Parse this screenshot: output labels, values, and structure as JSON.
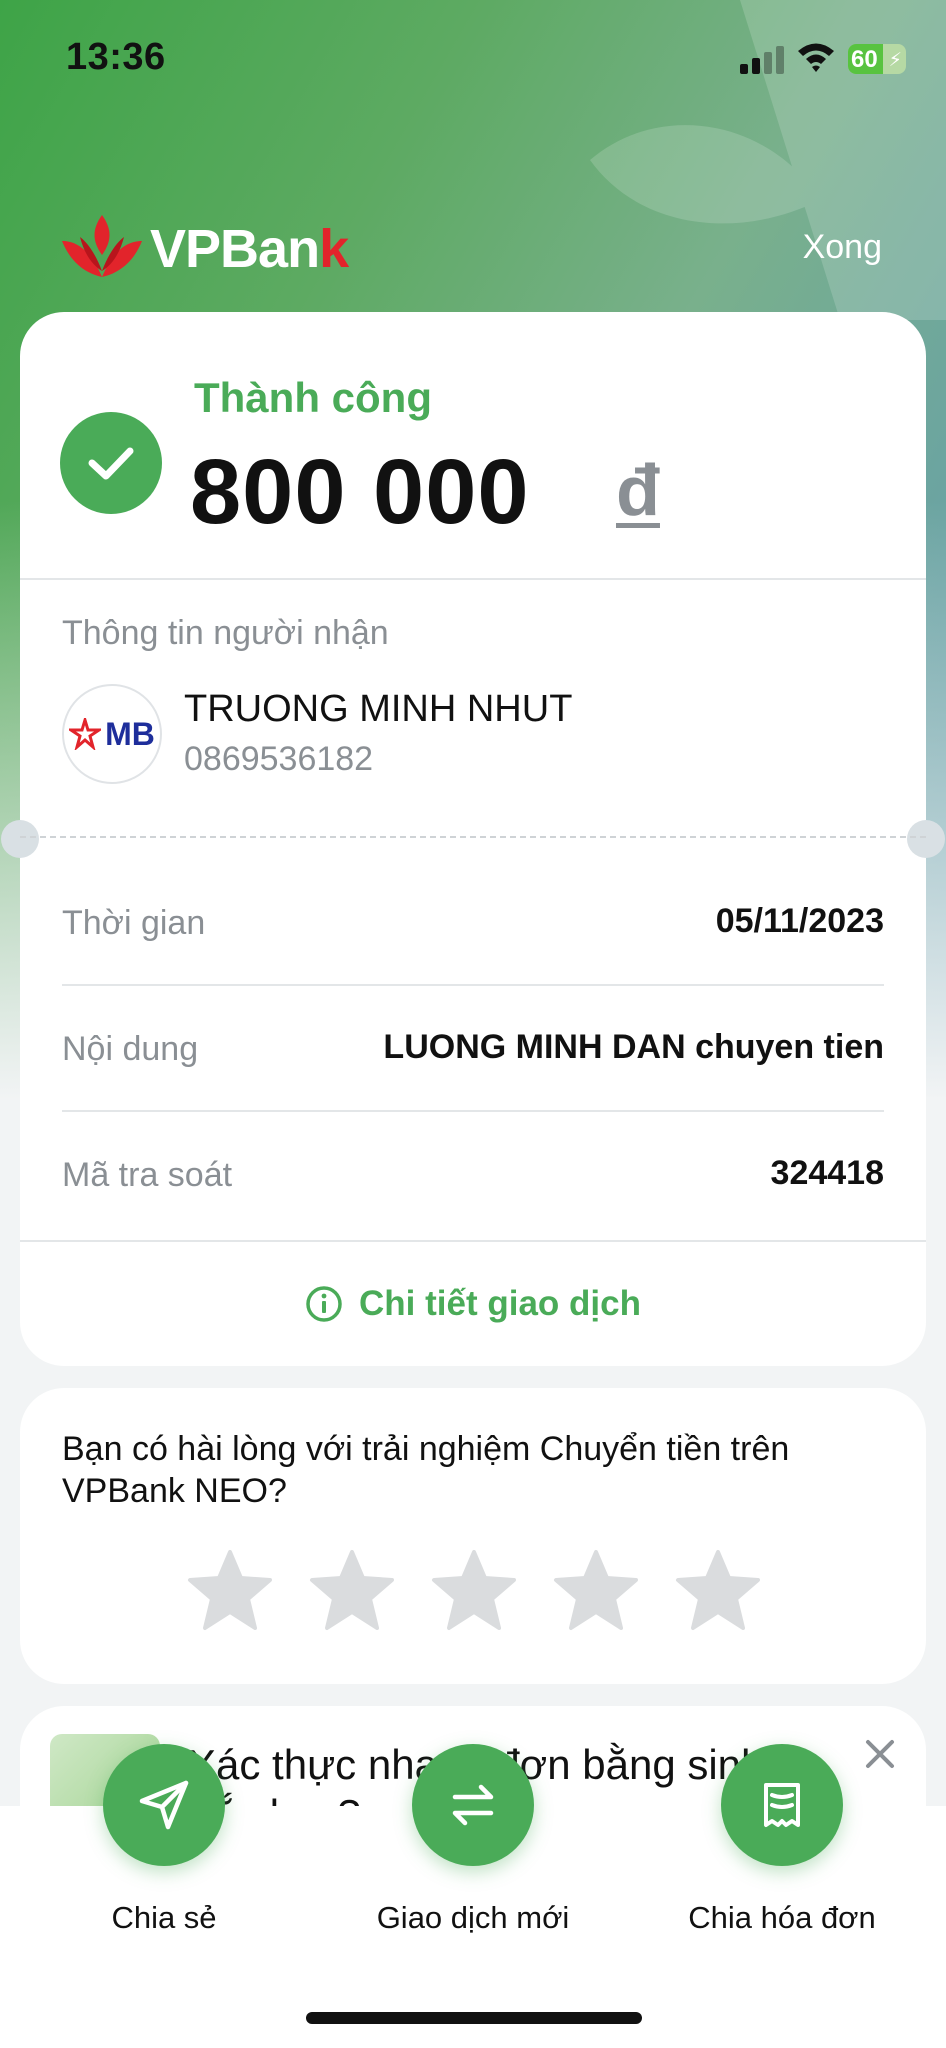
{
  "status_bar": {
    "time": "13:36",
    "battery": "60",
    "battery_level": 0.6
  },
  "header": {
    "brand": "VPBan",
    "brand_k": "k",
    "done": "Xong"
  },
  "result": {
    "status": "Thành công",
    "amount": "800 000",
    "currency": "đ"
  },
  "recipient": {
    "title": "Thông tin người nhận",
    "bank": "MB",
    "name": "TRUONG MINH NHUT",
    "account": "0869536182"
  },
  "details": [
    {
      "label": "Thời gian",
      "value": "05/11/2023"
    },
    {
      "label": "Nội dung",
      "value": "LUONG MINH DAN chuyen tien"
    },
    {
      "label": "Mã tra soát",
      "value": "324418"
    }
  ],
  "detail_link": "Chi tiết giao dịch",
  "rating": {
    "question": "Bạn có hài lòng với trải nghiệm Chuyển tiền trên VPBank NEO?",
    "stars": 5,
    "selected": 0
  },
  "promo": {
    "text": "Xác thực nhanh đơn bằng sinh trắc học?"
  },
  "actions": [
    {
      "label": "Chia sẻ",
      "icon": "send-icon"
    },
    {
      "label": "Giao dịch mới",
      "icon": "swap-icon"
    },
    {
      "label": "Chia hóa đơn",
      "icon": "receipt-icon"
    }
  ],
  "colors": {
    "accent": "#4aab58",
    "brand_red": "#e2242b",
    "muted": "#8a8f94"
  }
}
